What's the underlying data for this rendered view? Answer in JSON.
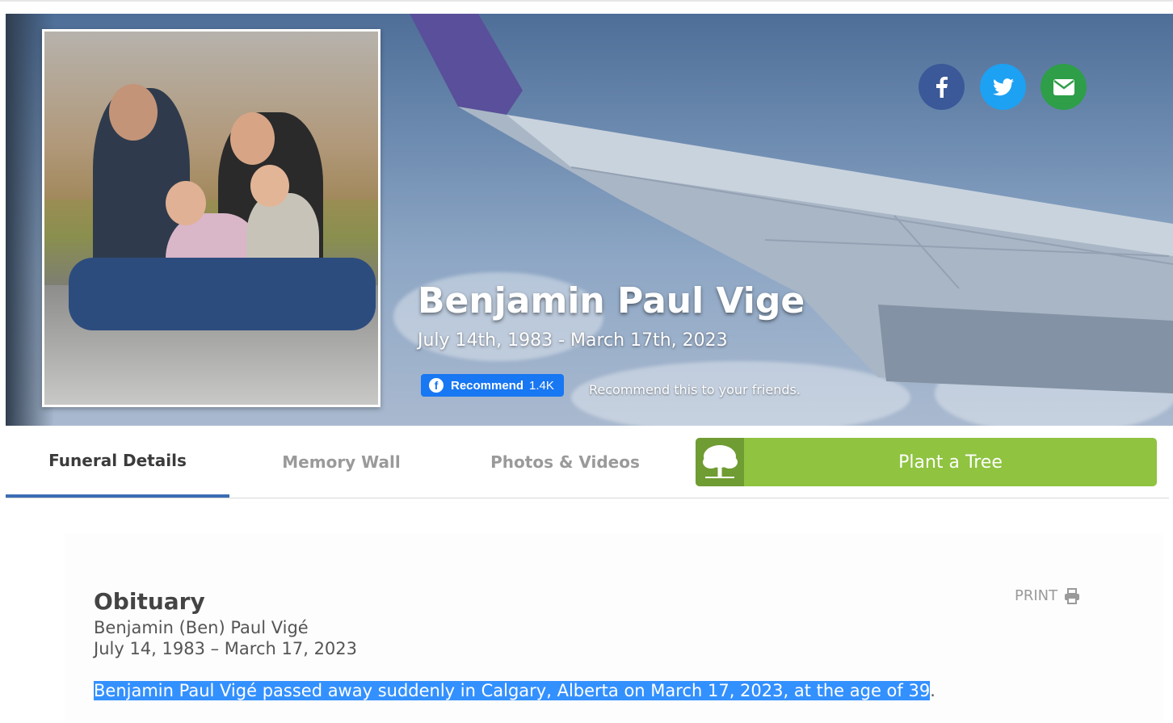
{
  "hero": {
    "name": "Benjamin Paul Vige",
    "dates": "July 14th, 1983 - March 17th, 2023",
    "recommend": {
      "label": "Recommend",
      "count": "1.4K",
      "text": "Recommend this to your friends."
    },
    "share": [
      {
        "name": "facebook-icon",
        "color": "#3b5998"
      },
      {
        "name": "twitter-icon",
        "color": "#1da1f2"
      },
      {
        "name": "email-icon",
        "color": "#2e9e48"
      }
    ]
  },
  "tabs": {
    "funeral_details": "Funeral Details",
    "memory_wall": "Memory Wall",
    "photos_videos": "Photos & Videos",
    "plant_tree": "Plant a Tree",
    "active_color": "#3d6db5",
    "plant_color": "#8fc340"
  },
  "obituary": {
    "title": "Obituary",
    "full_name": "Benjamin (Ben) Paul Vigé",
    "dates": "July 14, 1983 – March 17, 2023",
    "paragraph_selected": "Benjamin Paul Vigé passed away suddenly in Calgary, Alberta on March 17, 2023, at the age of 39",
    "paragraph_end": ".",
    "print_label": "PRINT"
  }
}
